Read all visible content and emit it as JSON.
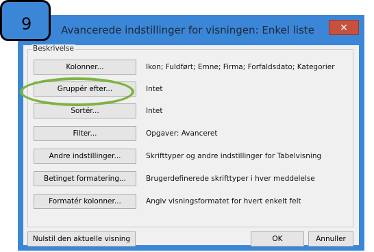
{
  "step_number": "9",
  "window": {
    "title": "Avancerede indstillinger for visningen: Enkel liste",
    "close_glyph": "✕"
  },
  "group": {
    "label": "Beskrivelse"
  },
  "rows": [
    {
      "button": "Kolonner...",
      "description": "Ikon; Fuldført; Emne; Firma; Forfaldsdato; Kategorier"
    },
    {
      "button": "Gruppér efter...",
      "description": "Intet"
    },
    {
      "button": "Sortér...",
      "description": "Intet"
    },
    {
      "button": "Filter...",
      "description": "Opgaver: Avanceret"
    },
    {
      "button": "Andre indstillinger...",
      "description": "Skrifttyper og andre indstillinger for Tabelvisning"
    },
    {
      "button": "Betinget formatering...",
      "description": "Brugerdefinerede skrifttyper i hver meddelelse"
    },
    {
      "button": "Formatér kolonner...",
      "description": "Angiv visningsformatet for hvert enkelt felt"
    }
  ],
  "footer": {
    "reset_label": "Nulstil den aktuelle visning",
    "ok_label": "OK",
    "cancel_label": "Annuller"
  },
  "colors": {
    "title_bar": "#3b86d6",
    "close_button": "#c7503f",
    "highlight_ring": "#7cb342"
  }
}
